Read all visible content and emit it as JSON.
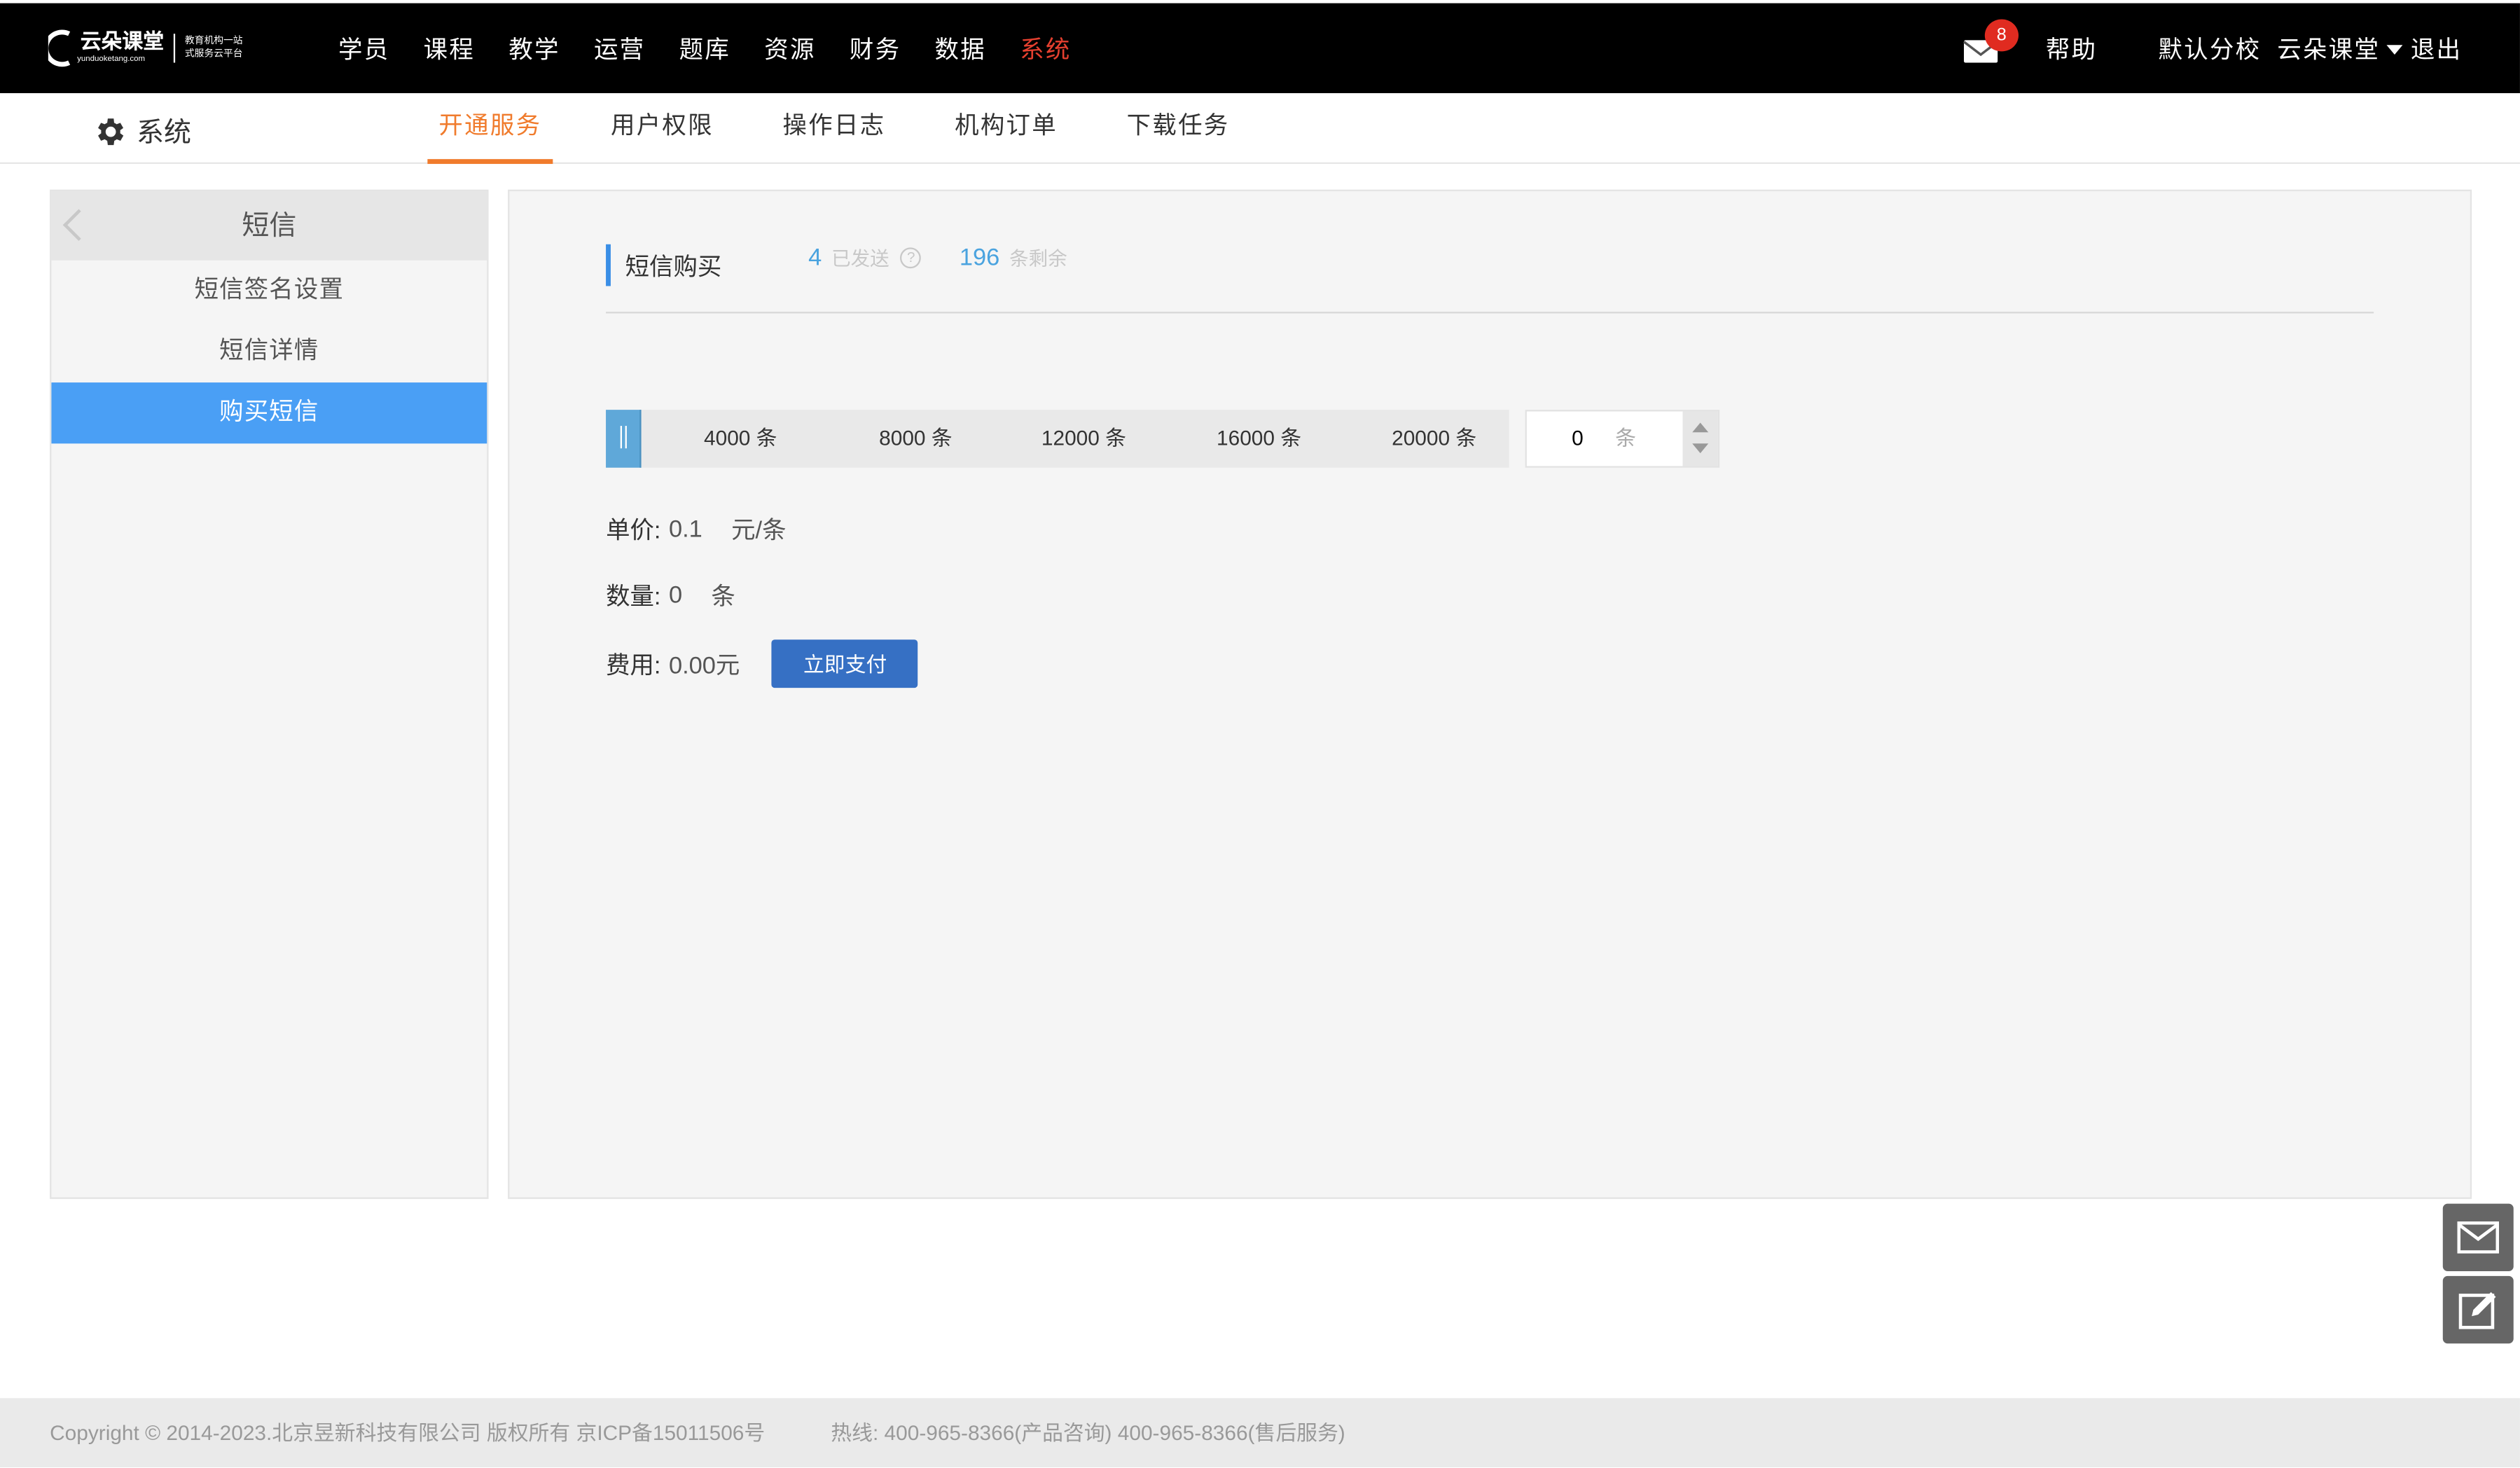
{
  "logo": {
    "name": "云朵课堂",
    "domain": "yunduoketang.com",
    "slogan_line1": "教育机构一站",
    "slogan_line2": "式服务云平台"
  },
  "nav": {
    "items": [
      {
        "label": "学员"
      },
      {
        "label": "课程"
      },
      {
        "label": "教学"
      },
      {
        "label": "运营"
      },
      {
        "label": "题库"
      },
      {
        "label": "资源"
      },
      {
        "label": "财务"
      },
      {
        "label": "数据"
      },
      {
        "label": "系统",
        "active": true
      }
    ]
  },
  "header": {
    "mail_badge": "8",
    "help": "帮助",
    "branch": "默认分校",
    "user": "云朵课堂",
    "logout": "退出"
  },
  "subnav": {
    "title": "系统",
    "tabs": [
      {
        "label": "开通服务",
        "active": true
      },
      {
        "label": "用户权限"
      },
      {
        "label": "操作日志"
      },
      {
        "label": "机构订单"
      },
      {
        "label": "下载任务"
      }
    ]
  },
  "sidebar": {
    "title": "短信",
    "items": [
      {
        "label": "短信签名设置"
      },
      {
        "label": "短信详情"
      },
      {
        "label": "购买短信",
        "active": true
      }
    ]
  },
  "panel": {
    "title": "短信购买",
    "sent_count": "4",
    "sent_label": "已发送",
    "remaining_count": "196",
    "remaining_label": "条剩余",
    "slider": {
      "marks": [
        "4000 条",
        "8000 条",
        "12000 条",
        "16000 条",
        "20000 条"
      ],
      "value": 0
    },
    "quantity_input": {
      "value": "0",
      "unit": "条"
    },
    "price_label": "单价:",
    "price_value": "0.1",
    "price_unit": "元/条",
    "qty_label": "数量:",
    "qty_value": "0",
    "qty_unit": "条",
    "cost_label": "费用:",
    "cost_value": "0.00元",
    "pay_button": "立即支付"
  },
  "footer": {
    "copyright": "Copyright © 2014-2023.北京昱新科技有限公司 版权所有 京ICP备15011506号",
    "hotline": "热线: 400-965-8366(产品咨询) 400-965-8366(售后服务)"
  },
  "colors": {
    "accent_orange": "#f07b2c",
    "nav_active_red": "#e5402f",
    "sidebar_active_blue": "#4a9ff5",
    "pay_button_blue": "#3670c4"
  }
}
